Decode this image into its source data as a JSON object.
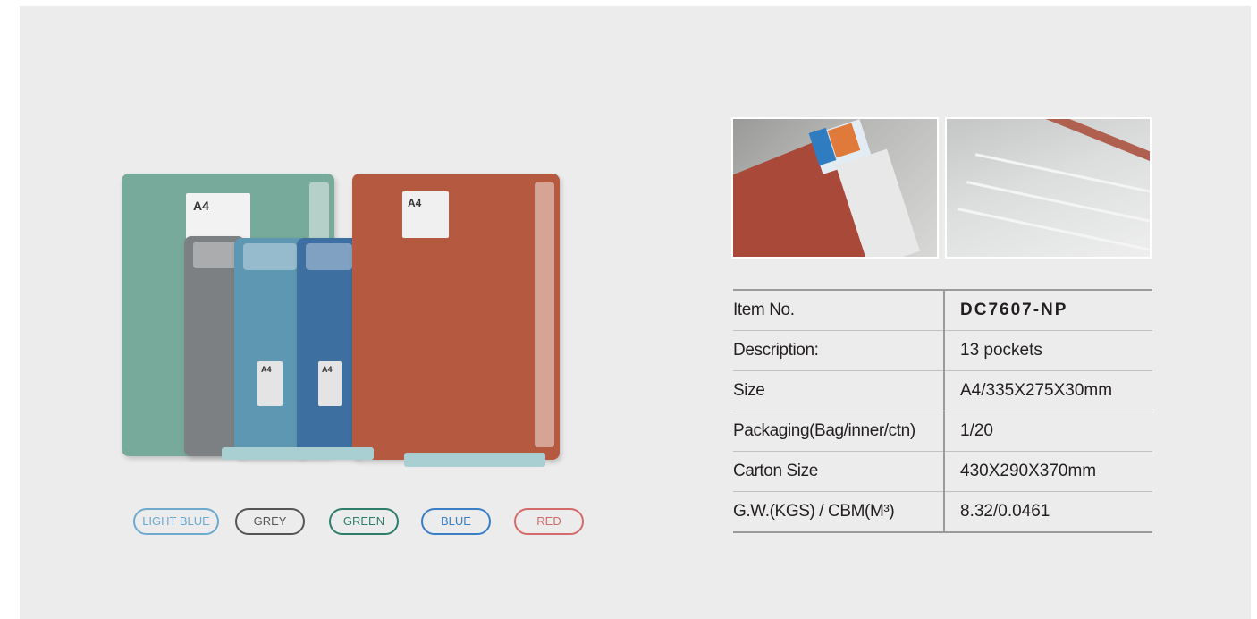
{
  "colors": {
    "panel_bg": "#ececec",
    "light_blue": "#6ea9cf",
    "grey": "#555555",
    "green": "#2e7d6a",
    "blue": "#3a7fc6",
    "red": "#d56a6a"
  },
  "product_image": {
    "file_labels": [
      "A4",
      "A4",
      "A4",
      "A4"
    ]
  },
  "color_options": [
    {
      "label": "LIGHT BLUE",
      "color": "#6ea9cf"
    },
    {
      "label": "GREY",
      "color": "#555555"
    },
    {
      "label": "GREEN",
      "color": "#2e7d6a"
    },
    {
      "label": "BLUE",
      "color": "#3a7fc6"
    },
    {
      "label": "RED",
      "color": "#d56a6a"
    }
  ],
  "specs": {
    "item_no_label": "Item No.",
    "item_no_value": "DC7607-NP",
    "description_label": "Description:",
    "description_value": "13 pockets",
    "size_label": "Size",
    "size_value": "A4/335X275X30mm",
    "packaging_label": "Packaging(Bag/inner/ctn)",
    "packaging_value": "1/20",
    "carton_label": "Carton Size",
    "carton_value": "430X290X370mm",
    "gw_label": "G.W.(KGS) / CBM(M³)",
    "gw_value": "8.32/0.0461"
  }
}
